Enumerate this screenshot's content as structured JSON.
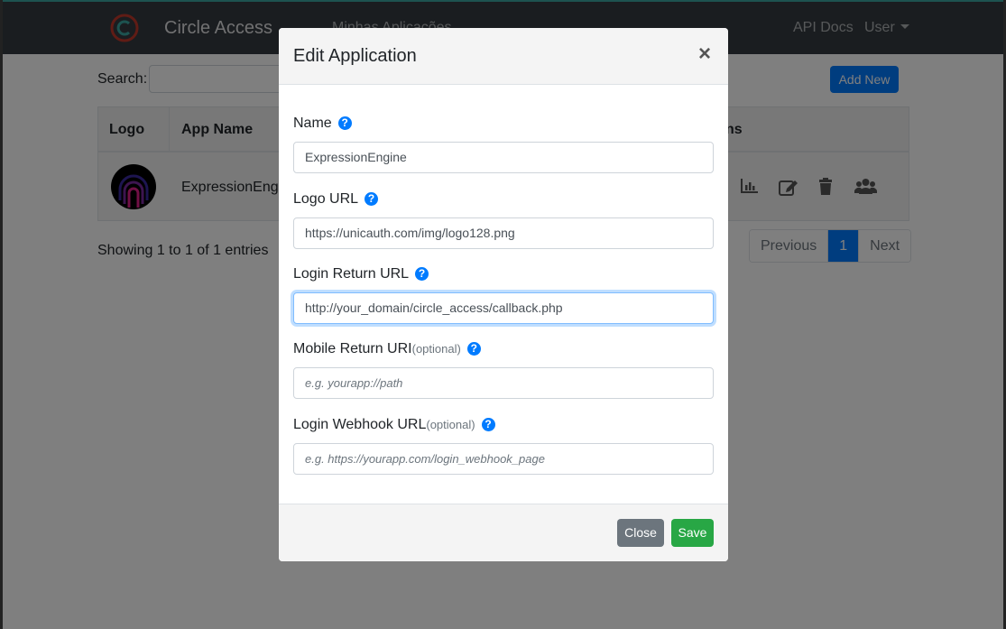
{
  "navbar": {
    "brand": "Circle Access",
    "apps_link": "Minhas Aplicações",
    "api_docs": "API Docs",
    "user": "User"
  },
  "toolbar": {
    "search_label": "Search:",
    "add_new": "Add New"
  },
  "table": {
    "headers": [
      "Logo",
      "App Name",
      "ns"
    ],
    "rows": [
      {
        "app_name": "ExpressionEngir"
      }
    ]
  },
  "footer": {
    "info": "Showing 1 to 1 of 1 entries",
    "previous": "Previous",
    "page": "1",
    "next": "Next"
  },
  "modal": {
    "title": "Edit Application",
    "close_symbol": "×",
    "fields": [
      {
        "label": "Name",
        "optional": "",
        "value": "ExpressionEngine",
        "placeholder": ""
      },
      {
        "label": "Logo URL",
        "optional": "",
        "value": "https://unicauth.com/img/logo128.png",
        "placeholder": ""
      },
      {
        "label": "Login Return URL",
        "optional": "",
        "value": "http://your_domain/circle_access/callback.php",
        "placeholder": ""
      },
      {
        "label": "Mobile Return URI",
        "optional": "(optional)",
        "value": "",
        "placeholder": "e.g. yourapp://path"
      },
      {
        "label": "Login Webhook URL",
        "optional": "(optional)",
        "value": "",
        "placeholder": "e.g. https://yourapp.com/login_webhook_page"
      }
    ],
    "help_symbol": "?",
    "close_button": "Close",
    "save_button": "Save"
  },
  "colors": {
    "primary": "#007bff",
    "success": "#28a745",
    "secondary": "#6c757d",
    "navbar": "#343a40"
  }
}
